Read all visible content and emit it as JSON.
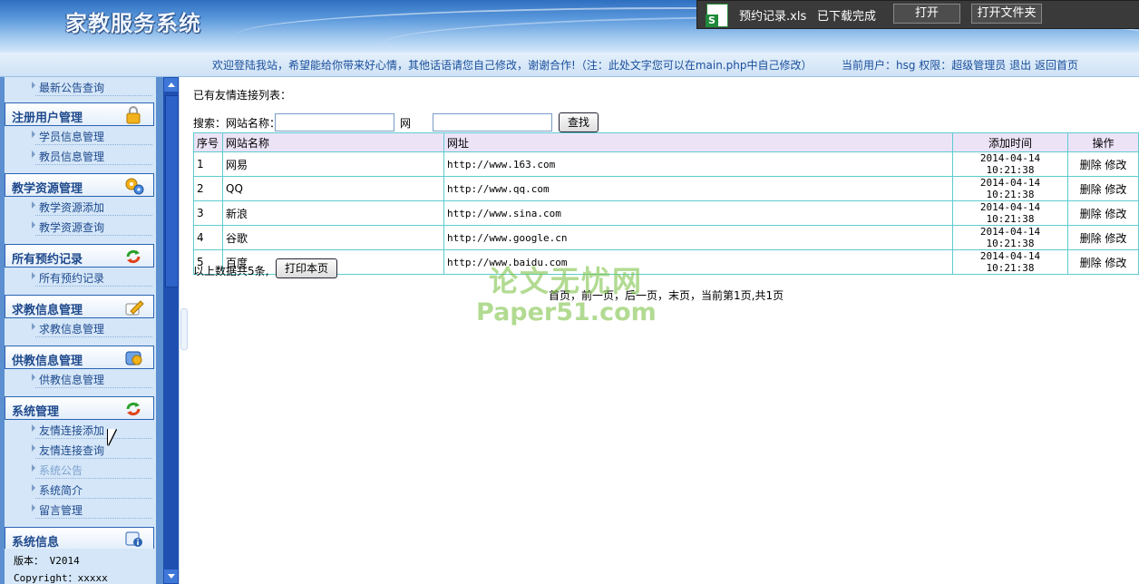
{
  "header": {
    "site_title": "家教服务系统"
  },
  "download_bar": {
    "file_name": "预约记录.xls",
    "status": "已下载完成",
    "open_label": "打开",
    "open_folder_label": "打开文件夹"
  },
  "welcome": {
    "message": "欢迎登陆我站，希望能给你带来好心情，其他话语请您自己修改，谢谢合作!（注：此处文字您可以在main.php中自己修改）",
    "current_user": "当前用户：hsg 权限：超级管理员",
    "logout": "退出",
    "home": "返回首页"
  },
  "sidebar": {
    "top_item": "最新公告查询",
    "sections": [
      {
        "title": "注册用户管理",
        "icon": "lock-icon",
        "items": [
          "学员信息管理",
          "教员信息管理"
        ]
      },
      {
        "title": "教学资源管理",
        "icon": "gears-icon",
        "items": [
          "教学资源添加",
          "教学资源查询"
        ]
      },
      {
        "title": "所有预约记录",
        "icon": "refresh-icon",
        "items": [
          "所有预约记录"
        ]
      },
      {
        "title": "求教信息管理",
        "icon": "edit-icon",
        "items": [
          "求教信息管理"
        ]
      },
      {
        "title": "供教信息管理",
        "icon": "tools-icon",
        "items": [
          "供教信息管理"
        ]
      },
      {
        "title": "系统管理",
        "icon": "refresh-icon",
        "items": [
          "友情连接添加",
          "友情连接查询",
          "系统公告",
          "系统简介",
          "留言管理"
        ]
      },
      {
        "title": "系统信息",
        "icon": "info-icon",
        "items": []
      }
    ],
    "sysinfo": {
      "version": "版本： V2014",
      "copyright": "Copyright：xxxxx"
    }
  },
  "main": {
    "list_title": "已有友情连接列表：",
    "search": {
      "label_name": "搜索：网站名称：",
      "label_url": "网址：",
      "name_value": "",
      "url_value": "",
      "button": "查找"
    },
    "table": {
      "headers": [
        "序号",
        "网站名称",
        "网址",
        "添加时间",
        "操作"
      ],
      "rows": [
        {
          "no": "1",
          "name": "网易",
          "url": "http://www.163.com",
          "time": "2014-04-14 10:21:38"
        },
        {
          "no": "2",
          "name": "QQ",
          "url": "http://www.qq.com",
          "time": "2014-04-14 10:21:38"
        },
        {
          "no": "3",
          "name": "新浪",
          "url": "http://www.sina.com",
          "time": "2014-04-14 10:21:38"
        },
        {
          "no": "4",
          "name": "谷歌",
          "url": "http://www.google.cn",
          "time": "2014-04-14 10:21:38"
        },
        {
          "no": "5",
          "name": "百度",
          "url": "http://www.baidu.com",
          "time": "2014-04-14 10:21:38"
        }
      ],
      "delete_label": "删除",
      "edit_label": "修改"
    },
    "summary": "以上数据共5条,",
    "print_button": "打印本页",
    "pager": "首页，前一页，后一页，末页，当前第1页,共1页"
  },
  "watermark": {
    "line1": "论文无忧网",
    "line2": "Paper51.com"
  }
}
